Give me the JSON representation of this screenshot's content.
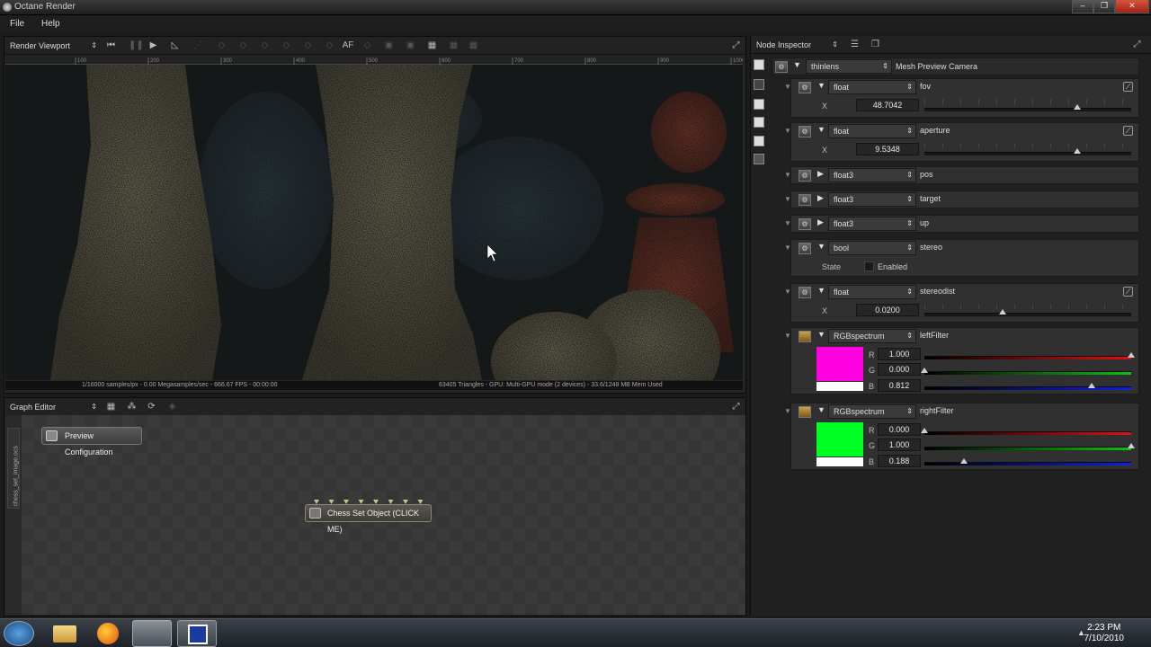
{
  "window": {
    "title": "Octane Render"
  },
  "menu": {
    "file": "File",
    "help": "Help"
  },
  "render_viewport": {
    "panel_name": "Render Viewport",
    "toolbar_af": "AF",
    "ruler_ticks": [
      "100",
      "200",
      "300",
      "400",
      "500",
      "600",
      "700",
      "800",
      "900",
      "1000"
    ],
    "status_left": "1/16000 samples/px - 0.00 Megasamples/sec - 666.67 FPS - 00:00:00",
    "status_right": "63405 Triangles - GPU: Multi-GPU mode (2 devices) - 33.6/1248 MB Mem Used"
  },
  "graph_editor": {
    "panel_name": "Graph Editor",
    "side_tab": "chess_set_image.ocs",
    "preview_node": "Preview Configuration",
    "object_node": "Chess Set Object (CLICK ME)"
  },
  "node_inspector": {
    "panel_name": "Node Inspector",
    "root_type": "thinlens",
    "root_name": "Mesh Preview Camera",
    "params": {
      "fov": {
        "type": "float",
        "name": "fov",
        "axis": "X",
        "value": "48.7042",
        "slider_fraction": 0.74
      },
      "aperture": {
        "type": "float",
        "name": "aperture",
        "axis": "X",
        "value": "9.5348",
        "slider_fraction": 0.74
      },
      "pos": {
        "type": "float3",
        "name": "pos"
      },
      "target": {
        "type": "float3",
        "name": "target"
      },
      "up": {
        "type": "float3",
        "name": "up"
      },
      "stereo": {
        "type": "bool",
        "name": "stereo",
        "state_label": "State",
        "enabled_label": "Enabled",
        "enabled": false
      },
      "stereodist": {
        "type": "float",
        "name": "stereodist",
        "axis": "X",
        "value": "0.0200",
        "slider_fraction": 0.38
      },
      "leftFilter": {
        "type": "RGBspectrum",
        "name": "leftFilter",
        "color": "#ff00e0",
        "r_label": "R",
        "r": "1.000",
        "r_fraction": 1.0,
        "g_label": "G",
        "g": "0.000",
        "g_fraction": 0.0,
        "b_label": "B",
        "b": "0.812",
        "b_fraction": 0.81
      },
      "rightFilter": {
        "type": "RGBspectrum",
        "name": "rightFilter",
        "color": "#00ff22",
        "r_label": "R",
        "r": "0.000",
        "r_fraction": 0.0,
        "g_label": "G",
        "g": "1.000",
        "g_fraction": 1.0,
        "b_label": "B",
        "b": "0.188",
        "b_fraction": 0.19
      }
    }
  },
  "taskbar": {
    "time": "2:23 PM",
    "date": "7/10/2010"
  },
  "icons": [
    "octane-logo-icon",
    "first-frame-icon",
    "pause-icon",
    "play-icon",
    "measure-icon",
    "maximize-icon",
    "gear-icon",
    "collapse-triangle-icon",
    "curve-icon",
    "folder-icon",
    "windows-start-icon",
    "explorer-icon",
    "firefox-icon"
  ]
}
